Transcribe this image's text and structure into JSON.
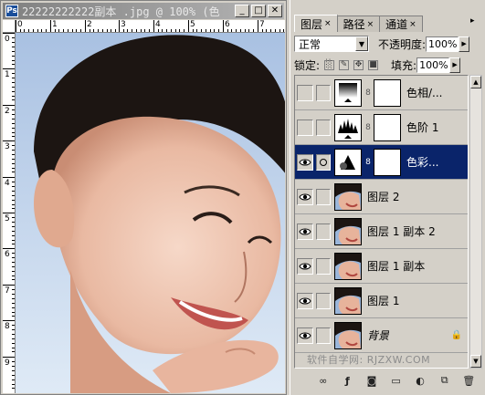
{
  "document": {
    "title": "22222222222副本 .jpg @ 100% (色",
    "controls": {
      "minimize": "_",
      "maximize": "□",
      "close": "✕"
    },
    "ruler_top_labels": [
      "0",
      "1",
      "2",
      "3",
      "4",
      "5",
      "6",
      "7"
    ],
    "ruler_left_labels": [
      "0",
      "1",
      "2",
      "3",
      "4",
      "5",
      "6",
      "7",
      "8",
      "9"
    ]
  },
  "panel": {
    "tabs": [
      {
        "label": "图层",
        "active": true
      },
      {
        "label": "路径",
        "active": false
      },
      {
        "label": "通道",
        "active": false
      }
    ],
    "blend_mode": "正常",
    "opacity_label": "不透明度:",
    "opacity_value": "100%",
    "lock_label": "锁定:",
    "fill_label": "填充:",
    "fill_value": "100%",
    "layers": [
      {
        "name": "色相/...",
        "visible": false,
        "thumb": "hue-saturation-adjustment",
        "has_mask": true,
        "selected": false
      },
      {
        "name": "色阶 1",
        "visible": false,
        "thumb": "levels-adjustment",
        "has_mask": true,
        "selected": false
      },
      {
        "name": "色彩...",
        "visible": true,
        "thumb": "color-balance-adjustment",
        "has_mask": true,
        "selected": true
      },
      {
        "name": "图层 2",
        "visible": true,
        "thumb": "photo",
        "has_mask": false,
        "selected": false
      },
      {
        "name": "图层 1 副本 2",
        "visible": true,
        "thumb": "photo",
        "has_mask": false,
        "selected": false
      },
      {
        "name": "图层 1 副本",
        "visible": true,
        "thumb": "photo",
        "has_mask": false,
        "selected": false
      },
      {
        "name": "图层 1",
        "visible": true,
        "thumb": "photo",
        "has_mask": false,
        "selected": false
      },
      {
        "name": "背景",
        "visible": true,
        "thumb": "photo",
        "has_mask": false,
        "selected": false,
        "locked": true
      }
    ],
    "watermark": "软件自学网: RJZXW.COM",
    "bottom_icons": [
      "link-layers-icon",
      "layer-style-icon",
      "add-mask-icon",
      "new-group-icon",
      "new-adjustment-layer-icon",
      "new-layer-icon",
      "delete-layer-icon"
    ]
  },
  "colors": {
    "selection": "#0a246a",
    "panel_bg": "#d4d0c8",
    "sky": "#c5d8ee"
  }
}
